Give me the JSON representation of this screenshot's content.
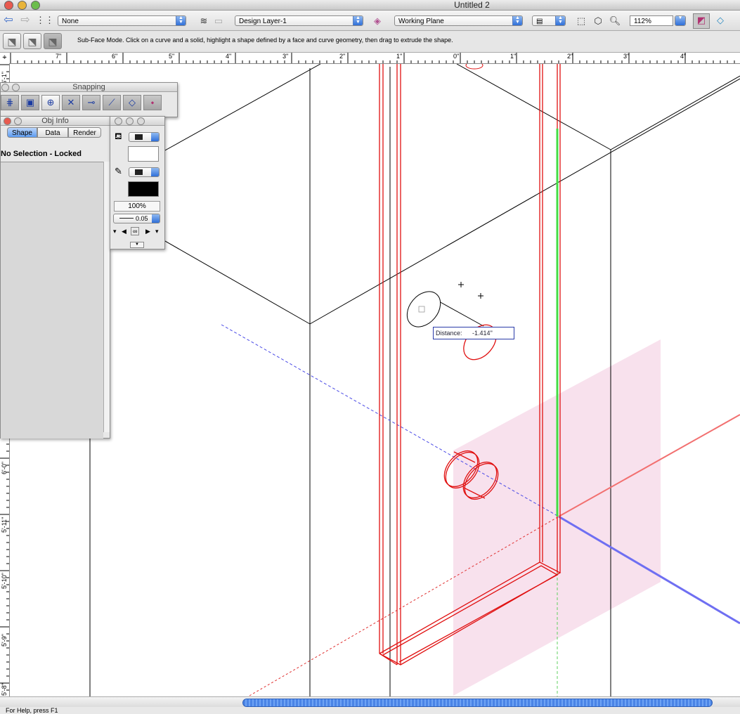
{
  "window": {
    "title": "Untitled 2"
  },
  "toolbar": {
    "class_popup": "None",
    "layer_popup": "Design Layer-1",
    "plane_popup": "Working Plane",
    "zoom_value": "112%"
  },
  "mode_bar": {
    "hint": "Sub-Face Mode. Click on a curve and a solid, highlight a shape defined by a face and curve geometry, then drag to extrude the shape."
  },
  "rulers": {
    "horizontal": [
      "7\"",
      "6\"",
      "5\"",
      "4\"",
      "3\"",
      "2\"",
      "1\"",
      "0\"",
      "1\"",
      "2\"",
      "3\"",
      "4\""
    ],
    "vertical": [
      "6'-1\"",
      "6'-0\"",
      "5'-11\"",
      "5'-10\"",
      "5'-9\"",
      "5'-8\""
    ]
  },
  "snapping_palette": {
    "title": "Snapping"
  },
  "obj_info": {
    "title": "Obj Info",
    "tabs": [
      "Shape",
      "Data",
      "Render"
    ],
    "selection_text": "No Selection - Locked",
    "opacity": "100%",
    "line_weight": "0.05"
  },
  "canvas": {
    "distance_label": "Distance:",
    "distance_value": "-1.414\""
  },
  "status": {
    "text": "For Help, press F1"
  },
  "colors": {
    "accent_blue": "#3a78e0",
    "red_outline": "#e01010",
    "pink_plane": "#f7dcea",
    "axis_blue": "#6f6ff2",
    "axis_red": "#f27070"
  }
}
